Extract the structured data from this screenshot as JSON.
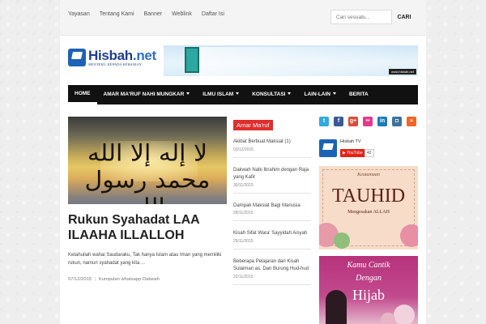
{
  "topnav": [
    "Yayasan",
    "Tentang Kami",
    "Banner",
    "Weblink",
    "Daftar Isi"
  ],
  "search": {
    "placeholder": "Cari sesuatu...",
    "button": "CARI"
  },
  "logo": {
    "name_main": "Hisbah",
    "name_suffix": ".net",
    "tagline": "MENYERU KEPADA KEBAIKAN"
  },
  "banner": {
    "url": "www.hisbah.net"
  },
  "mainnav": [
    {
      "label": "HOME",
      "dropdown": false,
      "active": true
    },
    {
      "label": "AMAR MA'RUF NAHI MUNGKAR",
      "dropdown": true,
      "active": false
    },
    {
      "label": "ILMU ISLAM",
      "dropdown": true,
      "active": false
    },
    {
      "label": "KONSULTASI",
      "dropdown": true,
      "active": false
    },
    {
      "label": "LAIN-LAIN",
      "dropdown": true,
      "active": false
    },
    {
      "label": "BERITA",
      "dropdown": false,
      "active": false
    }
  ],
  "featured": {
    "image_text": "لا إله إلا الله محمد رسول الله",
    "title": "Rukun Syahadat LAA ILAAHA ILLALLOH",
    "excerpt": "Ketahuilah wahai Saudaraku, Tak hanya Islam atau Iman yang memiliki rukun, namun syahadat yang kita ...",
    "date": "07/12/2015",
    "separator": "|",
    "category": "Kumpulan whatsapp Dakwah"
  },
  "amar": {
    "label": "Amar Ma'ruf",
    "items": [
      {
        "title": "Akibat Berbuat Maksiat (1)",
        "date": "03/12/2015"
      },
      {
        "title": "Dakwah Nabi Ibrahim dengan Raja yang Kafir",
        "date": "30/11/2015"
      },
      {
        "title": "Dampak Maksiat Bagi Manusia",
        "date": "28/11/2015"
      },
      {
        "title": "Kisah Sifat Wara' Sayyidah Aisyah",
        "date": "25/11/2015"
      },
      {
        "title": "Beberapa Pelajaran dari Kisah Sulaiman as. Dan Burung Hud-hud",
        "date": "22/11/2015"
      }
    ]
  },
  "social": {
    "twitter": "t",
    "facebook": "f",
    "gplus": "g+",
    "flickr": "••",
    "linkedin": "in",
    "instagram": "◘",
    "rss": "≈",
    "colors": {
      "twitter": "#2fa9e0",
      "facebook": "#3b5998",
      "gplus": "#dd4b39",
      "flickr": "#e6398c",
      "linkedin": "#1d7bb5",
      "instagram": "#3f729b",
      "rss": "#f26522"
    }
  },
  "youtube": {
    "channel": "Hisbah TV",
    "button": "▶ YouTube",
    "count": "42"
  },
  "ad1": {
    "small": "Keutamaan",
    "big": "TAUHID",
    "sub": "Mengesakan ALLAH"
  },
  "ad2": {
    "line1": "Kamu Cantik",
    "line2": "Dengan",
    "line3": "Hijab"
  },
  "colors": {
    "accent_red": "#e02d2d",
    "nav_bg": "#111111",
    "brand_blue": "#1e3d8f"
  }
}
